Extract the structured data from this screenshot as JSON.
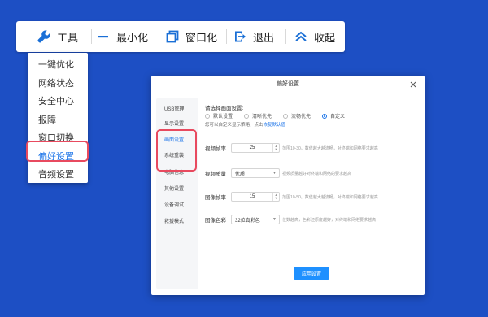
{
  "toolbar": {
    "tools_label": "工具",
    "minimize_label": "最小化",
    "window_label": "窗口化",
    "exit_label": "退出",
    "collapse_label": "收起"
  },
  "menu": {
    "items": [
      "一键优化",
      "网络状态",
      "安全中心",
      "报障",
      "窗口切换",
      "偏好设置",
      "音频设置"
    ],
    "active": "偏好设置"
  },
  "dialog": {
    "title": "偏好设置",
    "sidebar": [
      "USB管理",
      "显示设置",
      "画面设置",
      "系统重装",
      "电脑信息",
      "其他设置",
      "设备调试",
      "救援模式"
    ],
    "active_tab": "画面设置",
    "heading": "请选择画面设置:",
    "radios": [
      "默认设置",
      "清晰优先",
      "流畅优先",
      "自定义"
    ],
    "selected_radio": "自定义",
    "hint_text": "您可以自定义显示策略，点击",
    "hint_link": "恢复默认值",
    "fields": {
      "framerate_label": "视频帧率",
      "framerate_value": "25",
      "framerate_desc": "范围10-30。数值越大越流畅，对终端和网络要求越高",
      "quality_label": "视频质量",
      "quality_value": "优质",
      "quality_desc": "视频质量越好对终端和网络的要求越高",
      "imgrate_label": "图像帧率",
      "imgrate_value": "15",
      "imgrate_desc": "范围10-50。数值越大越流畅，对终端和网络要求越高",
      "color_label": "图像色彩",
      "color_value": "32位真彩色",
      "color_desc": "位数越高，色彩还原度越好，对终端和网络要求越高"
    },
    "apply_label": "应用设置"
  },
  "colors": {
    "background": "#1d4fc4",
    "accent": "#1a73e8",
    "highlight": "#e84a5f"
  }
}
